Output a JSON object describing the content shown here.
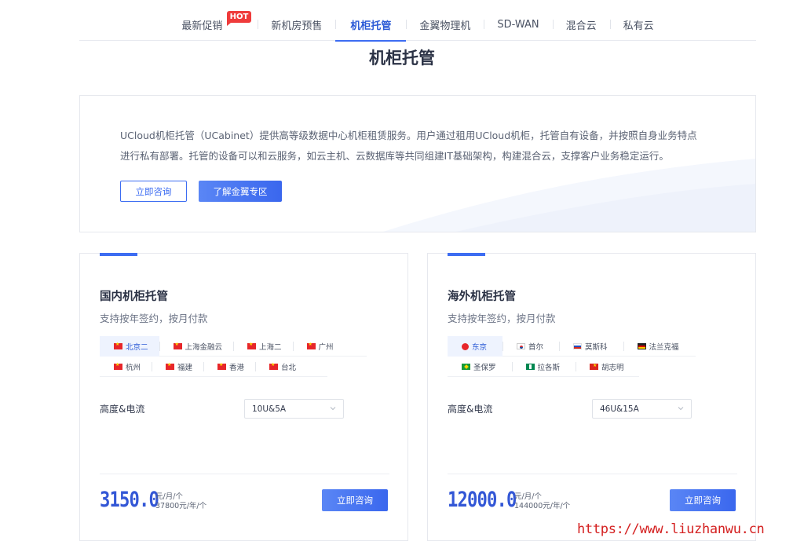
{
  "nav": {
    "items": [
      {
        "label": "最新促销"
      },
      {
        "label": "新机房预售"
      },
      {
        "label": "机柜托管"
      },
      {
        "label": "金翼物理机"
      },
      {
        "label": "SD-WAN"
      },
      {
        "label": "混合云"
      },
      {
        "label": "私有云"
      }
    ],
    "hot_badge": "HOT",
    "active_index": 2
  },
  "page_title": "机柜托管",
  "intro": {
    "text_line1": "UCloud机柜托管（UCabinet）提供高等级数据中心机柜租赁服务。用户通过租用UCloud机柜，托管自有设备，并按照自身业务特点",
    "text_line2": "进行私有部署。托管的设备可以和云服务，如云主机、云数据库等共同组建IT基础架构，构建混合云，支撑客户业务稳定运行。",
    "consult_label": "立即咨询",
    "learn_label": "了解金翼专区"
  },
  "cards": [
    {
      "title": "国内机柜托管",
      "subtitle": "支持按年签约，按月付款",
      "regions_row1": [
        {
          "label": "北京二",
          "flag": "cn",
          "active": true
        },
        {
          "label": "上海金融云",
          "flag": "cn"
        },
        {
          "label": "上海二",
          "flag": "cn"
        },
        {
          "label": "广州",
          "flag": "cn"
        }
      ],
      "regions_row2": [
        {
          "label": "杭州",
          "flag": "cn"
        },
        {
          "label": "福建",
          "flag": "cn"
        },
        {
          "label": "香港",
          "flag": "cn"
        },
        {
          "label": "台北",
          "flag": "cn"
        }
      ],
      "spec_label": "高度&电流",
      "spec_value": "10U&5A",
      "price": "3150.0",
      "unit_month": "元/月/个",
      "unit_year": "37800元/年/个",
      "consult_label": "立即咨询"
    },
    {
      "title": "海外机柜托管",
      "subtitle": "支持按年签约，按月付款",
      "regions_row1": [
        {
          "label": "东京",
          "flag": "jp",
          "active": true
        },
        {
          "label": "首尔",
          "flag": "kr"
        },
        {
          "label": "莫斯科",
          "flag": "ru"
        },
        {
          "label": "法兰克福",
          "flag": "de"
        }
      ],
      "regions_row2": [
        {
          "label": "圣保罗",
          "flag": "br"
        },
        {
          "label": "拉各斯",
          "flag": "ng"
        },
        {
          "label": "胡志明",
          "flag": "vn"
        }
      ],
      "spec_label": "高度&电流",
      "spec_value": "46U&15A",
      "price": "12000.0",
      "unit_month": "元/月/个",
      "unit_year": "144000元/年/个",
      "consult_label": "立即咨询"
    }
  ],
  "watermark": "https://www.liuzhanwu.cn",
  "colors": {
    "accent": "#3d6df2",
    "price": "#3357d6",
    "hot": "#ef3b3b",
    "watermark": "#d42020"
  }
}
